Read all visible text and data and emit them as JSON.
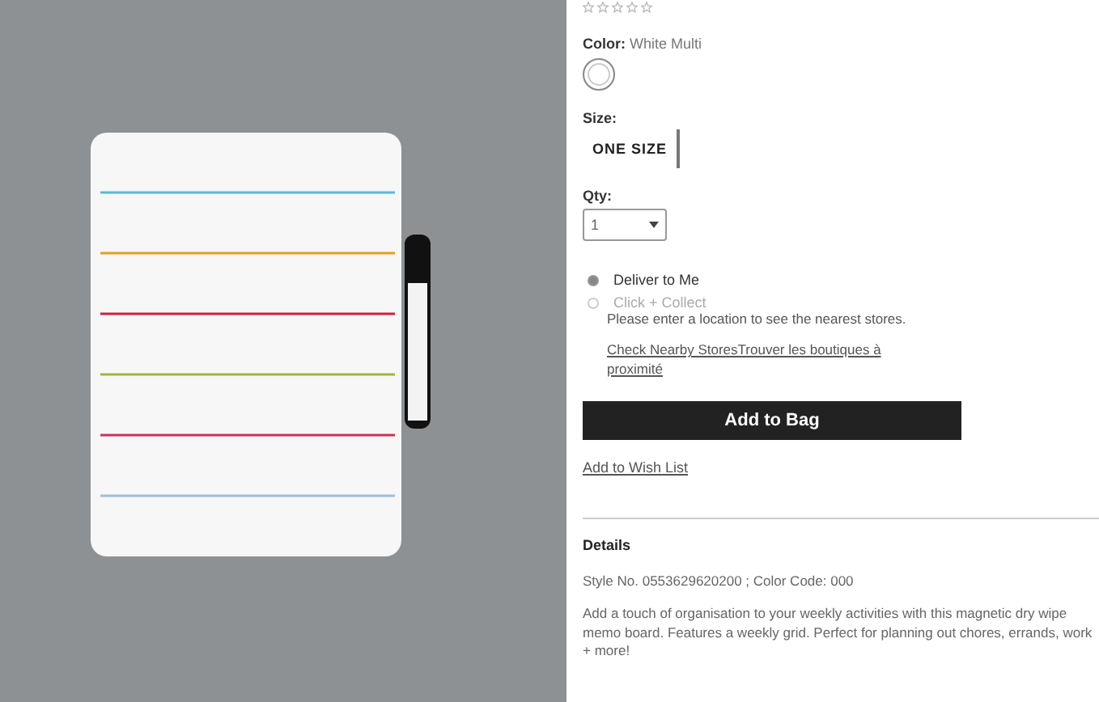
{
  "rating": {
    "stars": 0
  },
  "color": {
    "label": "Color:",
    "value": "White Multi"
  },
  "size": {
    "label": "Size:",
    "options": [
      {
        "label": "ONE SIZE",
        "selected": true
      }
    ]
  },
  "qty": {
    "label": "Qty:",
    "value": "1"
  },
  "delivery": [
    {
      "label": "Deliver to Me",
      "selected": true,
      "disabled": false
    },
    {
      "label": "Click + Collect",
      "selected": false,
      "disabled": true
    }
  ],
  "store_note": "Please enter a location to see the nearest stores.",
  "store_link": "Check Nearby StoresTrouver les boutiques à proximité",
  "add_button": "Add to Bag",
  "wish_link": "Add to Wish List",
  "details": {
    "heading": "Details",
    "style": "Style No. 0553629620200 ; Color Code: 000",
    "description": "Add a touch of organisation to your weekly activities with this magnetic dry wipe memo board. Features a weekly grid. Perfect for planning out chores, errands, work + more!"
  }
}
